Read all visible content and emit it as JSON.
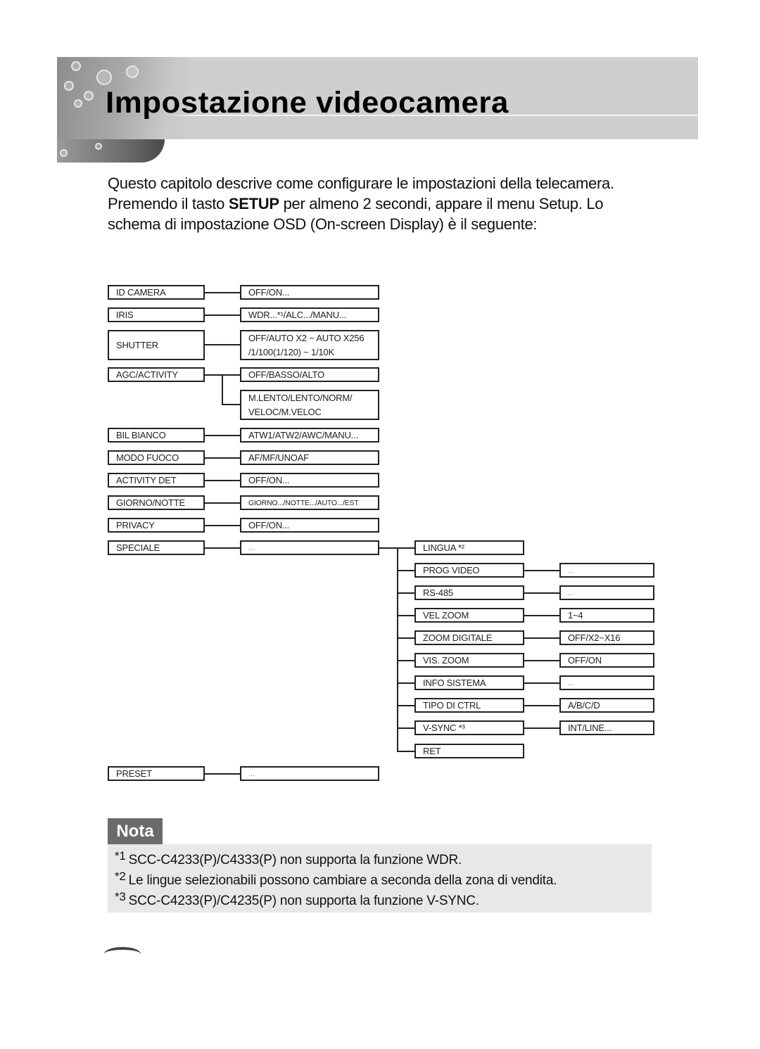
{
  "header": {
    "title": "Impostazione videocamera"
  },
  "intro": {
    "part1": "Questo capitolo descrive come configurare le impostazioni della telecamera. Premendo il tasto ",
    "bold": "SETUP",
    "part2": " per almeno 2 secondi, appare il menu Setup. Lo schema di impostazione OSD (On-screen Display) è il seguente:"
  },
  "menu": {
    "id_camera": {
      "label": "ID CAMERA",
      "value": "OFF/ON..."
    },
    "iris": {
      "label": "IRIS",
      "value": "WDR...*¹/ALC.../MANU..."
    },
    "shutter": {
      "label": "SHUTTER",
      "value_line1": "OFF/AUTO X2 ~ AUTO X256",
      "value_line2": "/1/100(1/120) ~ 1/10K"
    },
    "agc": {
      "label": "AGC/ACTIVITY",
      "value1": "OFF/BASSO/ALTO",
      "value2_line1": "M.LENTO/LENTO/NORM/",
      "value2_line2": "VELOC/M.VELOC"
    },
    "bil_bianco": {
      "label": "BIL BIANCO",
      "value": "ATW1/ATW2/AWC/MANU..."
    },
    "modo_fuoco": {
      "label": "MODO FUOCO",
      "value": "AF/MF/UNOAF"
    },
    "activity_det": {
      "label": "ACTIVITY DET",
      "value": "OFF/ON..."
    },
    "giorno_notte": {
      "label": "GIORNO/NOTTE",
      "value": "GIORNO.../NOTTE.../AUTO.../EST"
    },
    "privacy": {
      "label": "PRIVACY",
      "value": "OFF/ON..."
    },
    "speciale": {
      "label": "SPECIALE",
      "value": "..."
    },
    "preset": {
      "label": "PRESET",
      "value": "..."
    },
    "speciale_sub": [
      {
        "label": "LINGUA *²",
        "value": null
      },
      {
        "label": "PROG VIDEO",
        "value": "..."
      },
      {
        "label": "RS-485",
        "value": "..."
      },
      {
        "label": "VEL ZOOM",
        "value": "1~4"
      },
      {
        "label": "ZOOM DIGITALE",
        "value": "OFF/X2~X16"
      },
      {
        "label": "VIS. ZOOM",
        "value": "OFF/ON"
      },
      {
        "label": "INFO SISTEMA",
        "value": "..."
      },
      {
        "label": "TIPO DI CTRL",
        "value": "A/B/C/D"
      },
      {
        "label": "V-SYNC *³",
        "value": "INT/LINE..."
      },
      {
        "label": "RET",
        "value": null
      }
    ]
  },
  "nota": {
    "label": "Nota",
    "items": [
      {
        "mark": "*1",
        "text": "SCC-C4233(P)/C4333(P) non supporta la funzione WDR."
      },
      {
        "mark": "*2",
        "text": "Le lingue selezionabili possono cambiare a seconda della zona di vendita."
      },
      {
        "mark": "*3",
        "text": "SCC-C4233(P)/C4235(P) non supporta la funzione V-SYNC."
      }
    ]
  }
}
